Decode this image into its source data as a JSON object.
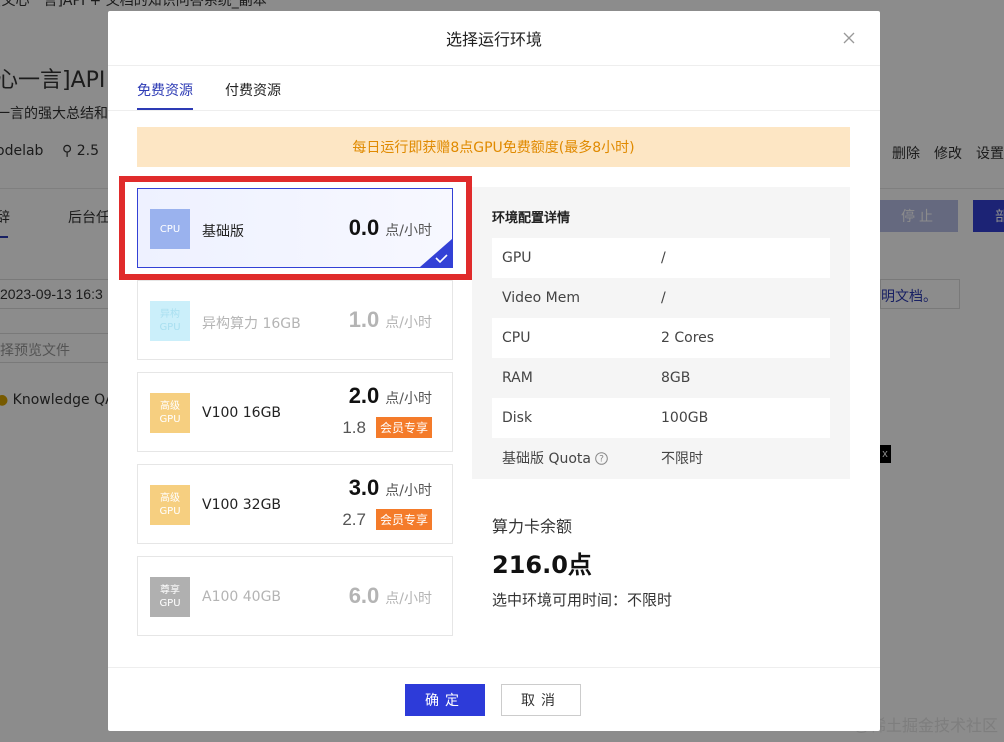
{
  "background": {
    "title_top": "[文心一言]API + 文档的知识问答系统_副本",
    "title": "心一言]API +",
    "desc": "一言的强大总结和抗",
    "meta": "odelab",
    "meta_count": "2.5",
    "actions": [
      "删除",
      "修改",
      "设置"
    ],
    "tab1": "辞",
    "tab2": "后台任",
    "stop_label": "停止",
    "deploy_label": "部",
    "date": "2023-09-13 16:3",
    "preview_placeholder": "择预览文件",
    "doc_link": "明文档。",
    "kqa": "Knowledge QA",
    "black_label": "x",
    "watermark": "@稀土掘金技术社区"
  },
  "modal": {
    "title": "选择运行环境",
    "tabs": [
      "免费资源",
      "付费资源"
    ],
    "notice": "每日运行即获赠8点GPU免费额度(最多8小时)",
    "cards": [
      {
        "badge": [
          "CPU"
        ],
        "name": "基础版",
        "price": "0.0",
        "unit": "点/小时",
        "selected": true
      },
      {
        "badge": [
          "异构",
          "GPU"
        ],
        "name": "异构算力 16GB",
        "price": "1.0",
        "unit": "点/小时",
        "disabled": true
      },
      {
        "badge": [
          "高级",
          "GPU"
        ],
        "name": "V100 16GB",
        "price": "2.0",
        "unit": "点/小时",
        "member_price": "1.8",
        "member_tag": "会员专享"
      },
      {
        "badge": [
          "高级",
          "GPU"
        ],
        "name": "V100 32GB",
        "price": "3.0",
        "unit": "点/小时",
        "member_price": "2.7",
        "member_tag": "会员专享"
      },
      {
        "badge": [
          "尊享",
          "GPU"
        ],
        "name": "A100 40GB",
        "price": "6.0",
        "unit": "点/小时",
        "disabled": true
      }
    ],
    "detail": {
      "title": "环境配置详情",
      "rows": [
        {
          "k": "GPU",
          "v": "/"
        },
        {
          "k": "Video Mem",
          "v": "/"
        },
        {
          "k": "CPU",
          "v": "2 Cores"
        },
        {
          "k": "RAM",
          "v": "8GB"
        },
        {
          "k": "Disk",
          "v": "100GB"
        },
        {
          "k": "基础版 Quota",
          "v": "不限时"
        }
      ]
    },
    "balance_label": "算力卡余额",
    "balance_value": "216.0点",
    "avail_text": "选中环境可用时间：不限时",
    "ok_label": "确定",
    "cancel_label": "取消"
  },
  "colors": {
    "accent": "#2d3bd9",
    "highlight": "#e02b2b",
    "notice_bg": "#fde6c4",
    "notice_text": "#e08a00"
  }
}
